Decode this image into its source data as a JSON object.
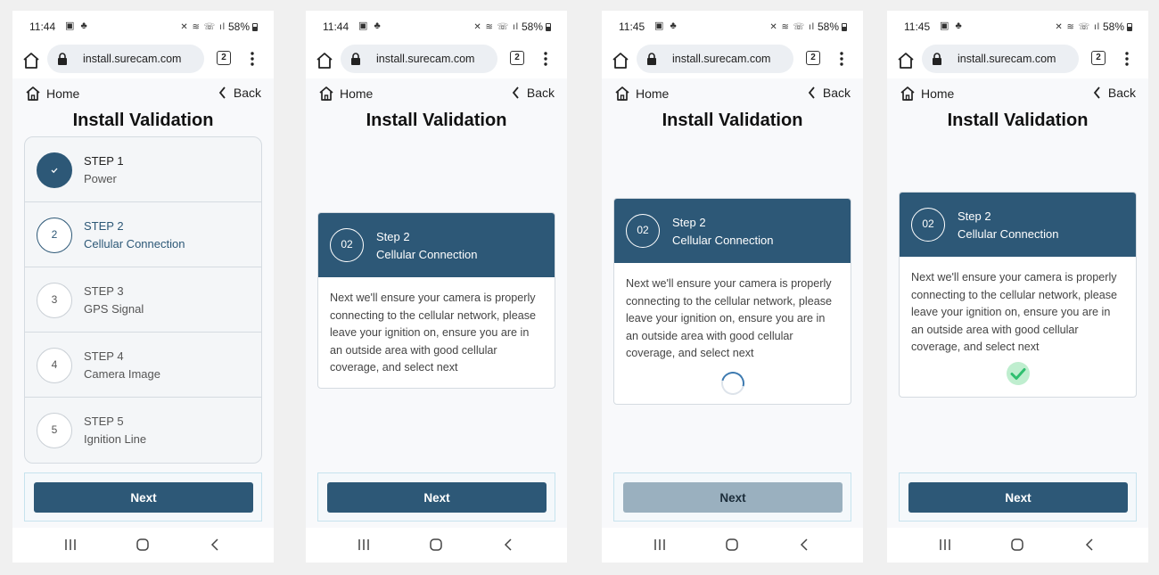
{
  "common": {
    "url": "install.surecam.com",
    "tab_count": "2",
    "battery": "58%",
    "home_label": "Home",
    "back_label": "Back",
    "title": "Install Validation",
    "next_label": "Next",
    "colors": {
      "primary": "#2d5877",
      "disabled_button": "#9ab0bf",
      "success": "#34c77b"
    }
  },
  "screens": [
    {
      "time": "11:44",
      "steps": [
        {
          "label": "STEP 1",
          "name": "Power",
          "marker": "",
          "state": "done"
        },
        {
          "label": "STEP 2",
          "name": "Cellular Connection",
          "marker": "2",
          "state": "active"
        },
        {
          "label": "STEP 3",
          "name": "GPS Signal",
          "marker": "3",
          "state": "pending"
        },
        {
          "label": "STEP 4",
          "name": "Camera Image",
          "marker": "4",
          "state": "pending"
        },
        {
          "label": "STEP 5",
          "name": "Ignition Line",
          "marker": "5",
          "state": "pending"
        }
      ]
    },
    {
      "time": "11:44",
      "card": {
        "number": "02",
        "step": "Step 2",
        "name": "Cellular Connection",
        "text": "Next we'll ensure your camera is properly connecting to the cellular network, please leave your ignition on, ensure you are in an outside area with good cellular coverage, and select next",
        "status": "idle"
      }
    },
    {
      "time": "11:45",
      "card": {
        "number": "02",
        "step": "Step 2",
        "name": "Cellular Connection",
        "text": "Next we'll ensure your camera is properly connecting to the cellular network, please leave your ignition on, ensure you are in an outside area with good cellular coverage, and select next",
        "status": "loading-spinner-icon"
      },
      "next_disabled": true
    },
    {
      "time": "11:45",
      "card": {
        "number": "02",
        "step": "Step 2",
        "name": "Cellular Connection",
        "text": "Next we'll ensure your camera is properly connecting to the cellular network, please leave your ignition on, ensure you are in an outside area with good cellular coverage, and select next",
        "status": "success-check-icon"
      }
    }
  ]
}
